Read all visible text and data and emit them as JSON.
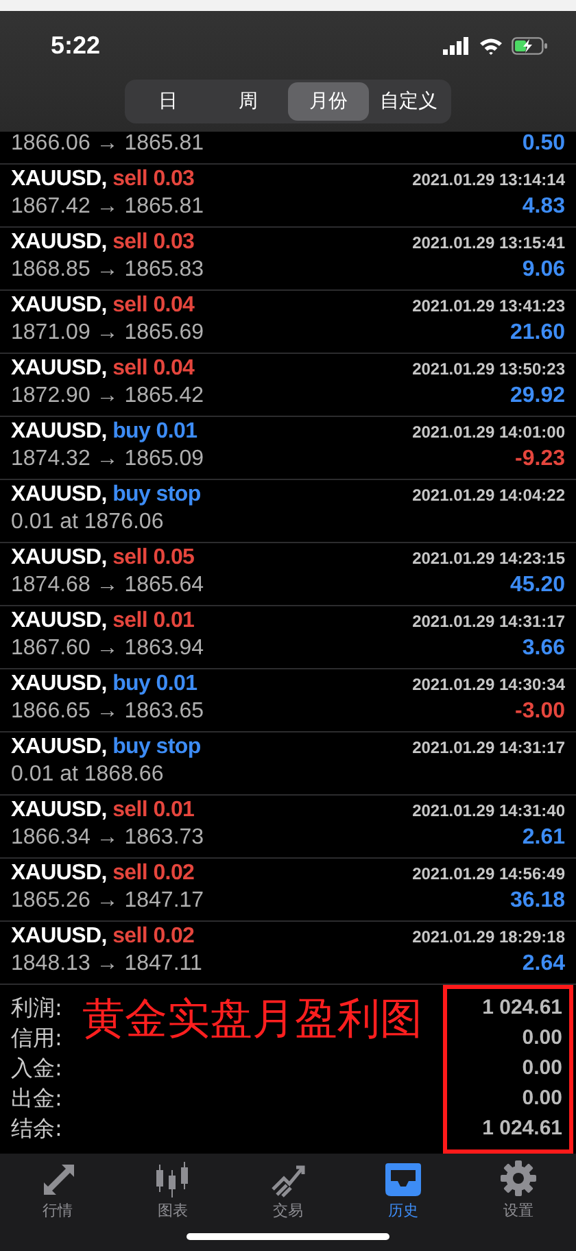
{
  "status_bar": {
    "time": "5:22"
  },
  "period_tabs": [
    {
      "label": "日",
      "selected": false
    },
    {
      "label": "周",
      "selected": false
    },
    {
      "label": "月份",
      "selected": true
    },
    {
      "label": "自定义",
      "selected": false
    }
  ],
  "deals": [
    {
      "prices": "1866.06 → 1865.81",
      "profit": "0.50",
      "loss": false
    },
    {
      "symbol": "XAUUSD,",
      "order": "sell 0.03",
      "kind": "sell",
      "time": "2021.01.29 13:14:14",
      "prices": "1867.42 → 1865.81",
      "profit": "4.83",
      "loss": false
    },
    {
      "symbol": "XAUUSD,",
      "order": "sell 0.03",
      "kind": "sell",
      "time": "2021.01.29 13:15:41",
      "prices": "1868.85 → 1865.83",
      "profit": "9.06",
      "loss": false
    },
    {
      "symbol": "XAUUSD,",
      "order": "sell 0.04",
      "kind": "sell",
      "time": "2021.01.29 13:41:23",
      "prices": "1871.09 → 1865.69",
      "profit": "21.60",
      "loss": false
    },
    {
      "symbol": "XAUUSD,",
      "order": "sell 0.04",
      "kind": "sell",
      "time": "2021.01.29 13:50:23",
      "prices": "1872.90 → 1865.42",
      "profit": "29.92",
      "loss": false
    },
    {
      "symbol": "XAUUSD,",
      "order": "buy 0.01",
      "kind": "buy",
      "time": "2021.01.29 14:01:00",
      "prices": "1874.32 → 1865.09",
      "profit": "-9.23",
      "loss": true
    },
    {
      "symbol": "XAUUSD,",
      "order": "buy stop",
      "kind": "buy",
      "time": "2021.01.29 14:04:22",
      "prices": "0.01 at 1876.06"
    },
    {
      "symbol": "XAUUSD,",
      "order": "sell 0.05",
      "kind": "sell",
      "time": "2021.01.29 14:23:15",
      "prices": "1874.68 → 1865.64",
      "profit": "45.20",
      "loss": false
    },
    {
      "symbol": "XAUUSD,",
      "order": "sell 0.01",
      "kind": "sell",
      "time": "2021.01.29 14:31:17",
      "prices": "1867.60 → 1863.94",
      "profit": "3.66",
      "loss": false
    },
    {
      "symbol": "XAUUSD,",
      "order": "buy 0.01",
      "kind": "buy",
      "time": "2021.01.29 14:30:34",
      "prices": "1866.65 → 1863.65",
      "profit": "-3.00",
      "loss": true
    },
    {
      "symbol": "XAUUSD,",
      "order": "buy stop",
      "kind": "buy",
      "time": "2021.01.29 14:31:17",
      "prices": "0.01 at 1868.66"
    },
    {
      "symbol": "XAUUSD,",
      "order": "sell 0.01",
      "kind": "sell",
      "time": "2021.01.29 14:31:40",
      "prices": "1866.34 → 1863.73",
      "profit": "2.61",
      "loss": false
    },
    {
      "symbol": "XAUUSD,",
      "order": "sell 0.02",
      "kind": "sell",
      "time": "2021.01.29 14:56:49",
      "prices": "1865.26 → 1847.17",
      "profit": "36.18",
      "loss": false
    },
    {
      "symbol": "XAUUSD,",
      "order": "sell 0.02",
      "kind": "sell",
      "time": "2021.01.29 18:29:18",
      "prices": "1848.13 → 1847.11",
      "profit": "2.64",
      "loss": false
    }
  ],
  "summary": [
    {
      "label": "利润:",
      "value": "1 024.61"
    },
    {
      "label": "信用:",
      "value": "0.00"
    },
    {
      "label": "入金:",
      "value": "0.00"
    },
    {
      "label": "出金:",
      "value": "0.00"
    },
    {
      "label": "结余:",
      "value": "1 024.61"
    }
  ],
  "annotation": {
    "text": "黄金实盘月盈利图",
    "boxed": true
  },
  "tab_bar": [
    {
      "label": "行情",
      "kind": "arrows",
      "selected": false
    },
    {
      "label": "图表",
      "kind": "candles",
      "selected": false
    },
    {
      "label": "交易",
      "kind": "trend",
      "selected": false
    },
    {
      "label": "历史",
      "kind": "inbox",
      "selected": true
    },
    {
      "label": "设置",
      "kind": "gear",
      "selected": false
    }
  ]
}
